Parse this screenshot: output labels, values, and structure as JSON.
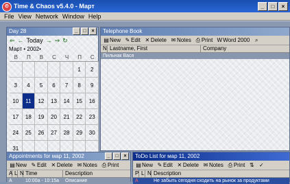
{
  "app": {
    "title": "Time & Chaos v5.4.0 - Март"
  },
  "menu": [
    "File",
    "View",
    "Network",
    "Window",
    "Help"
  ],
  "calendar": {
    "window_title": "Day 28",
    "nav_label": "Today",
    "month_label": "Март • 2002•",
    "dow": [
      "В",
      "П",
      "В",
      "С",
      "Ч",
      "П",
      "С"
    ],
    "days": [
      "",
      "",
      "",
      "",
      "",
      "1",
      "2",
      "3",
      "4",
      "5",
      "6",
      "7",
      "8",
      "9",
      "10",
      "11",
      "12",
      "13",
      "14",
      "15",
      "16",
      "17",
      "18",
      "19",
      "20",
      "21",
      "22",
      "23",
      "24",
      "25",
      "26",
      "27",
      "28",
      "29",
      "30",
      "31",
      "",
      "",
      "",
      "",
      "",
      ""
    ],
    "selected_day": "11"
  },
  "phonebook": {
    "window_title": "Telephone Book",
    "toolbar": {
      "new": "New",
      "edit": "Edit",
      "delete": "Delete",
      "notes": "Notes",
      "print": "Print",
      "word": "Word 2000"
    },
    "headers": {
      "n": "N",
      "name": "Lastname, First",
      "company": "Company"
    },
    "selected_row": "Пильнак Вася"
  },
  "appointments": {
    "window_title": "Appointments for мар 11, 2002",
    "toolbar": {
      "new": "New",
      "edit": "Edit",
      "delete": "Delete",
      "notes": "Notes",
      "print": "Print"
    },
    "headers": {
      "a": "A",
      "l": "L",
      "n": "N",
      "time": "Time",
      "description": "Description"
    },
    "row": {
      "a": "A",
      "time": "10:00a - 10:15a",
      "description": "Описание"
    }
  },
  "todo": {
    "window_title": "ToDo List for мар 11, 2002",
    "toolbar": {
      "new": "New",
      "edit": "Edit",
      "delete": "Delete",
      "notes": "Notes",
      "print": "Print"
    },
    "headers": {
      "p": "P",
      "l": "L",
      "n": "N",
      "description": "Description"
    },
    "row": {
      "p": "A",
      "description": "Не забыть сегодня сходить на рынок за продуктами"
    }
  }
}
